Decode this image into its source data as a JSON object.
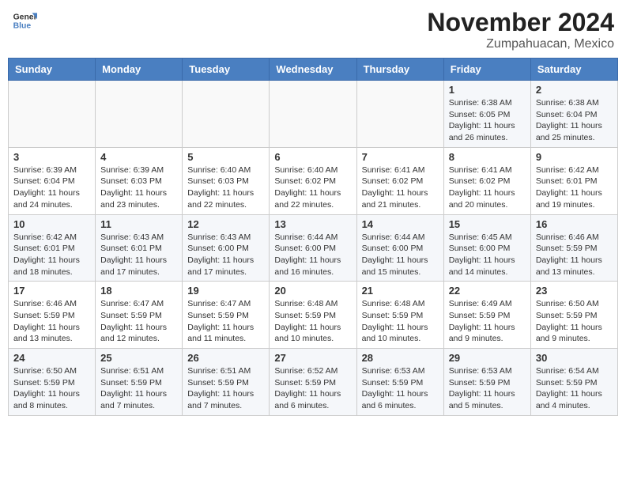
{
  "logo": {
    "name": "GeneralBlue",
    "line1": "General",
    "line2": "Blue"
  },
  "title": "November 2024",
  "location": "Zumpahuacan, Mexico",
  "weekdays": [
    "Sunday",
    "Monday",
    "Tuesday",
    "Wednesday",
    "Thursday",
    "Friday",
    "Saturday"
  ],
  "weeks": [
    [
      {
        "day": "",
        "info": ""
      },
      {
        "day": "",
        "info": ""
      },
      {
        "day": "",
        "info": ""
      },
      {
        "day": "",
        "info": ""
      },
      {
        "day": "",
        "info": ""
      },
      {
        "day": "1",
        "info": "Sunrise: 6:38 AM\nSunset: 6:05 PM\nDaylight: 11 hours and 26 minutes."
      },
      {
        "day": "2",
        "info": "Sunrise: 6:38 AM\nSunset: 6:04 PM\nDaylight: 11 hours and 25 minutes."
      }
    ],
    [
      {
        "day": "3",
        "info": "Sunrise: 6:39 AM\nSunset: 6:04 PM\nDaylight: 11 hours and 24 minutes."
      },
      {
        "day": "4",
        "info": "Sunrise: 6:39 AM\nSunset: 6:03 PM\nDaylight: 11 hours and 23 minutes."
      },
      {
        "day": "5",
        "info": "Sunrise: 6:40 AM\nSunset: 6:03 PM\nDaylight: 11 hours and 22 minutes."
      },
      {
        "day": "6",
        "info": "Sunrise: 6:40 AM\nSunset: 6:02 PM\nDaylight: 11 hours and 22 minutes."
      },
      {
        "day": "7",
        "info": "Sunrise: 6:41 AM\nSunset: 6:02 PM\nDaylight: 11 hours and 21 minutes."
      },
      {
        "day": "8",
        "info": "Sunrise: 6:41 AM\nSunset: 6:02 PM\nDaylight: 11 hours and 20 minutes."
      },
      {
        "day": "9",
        "info": "Sunrise: 6:42 AM\nSunset: 6:01 PM\nDaylight: 11 hours and 19 minutes."
      }
    ],
    [
      {
        "day": "10",
        "info": "Sunrise: 6:42 AM\nSunset: 6:01 PM\nDaylight: 11 hours and 18 minutes."
      },
      {
        "day": "11",
        "info": "Sunrise: 6:43 AM\nSunset: 6:01 PM\nDaylight: 11 hours and 17 minutes."
      },
      {
        "day": "12",
        "info": "Sunrise: 6:43 AM\nSunset: 6:00 PM\nDaylight: 11 hours and 17 minutes."
      },
      {
        "day": "13",
        "info": "Sunrise: 6:44 AM\nSunset: 6:00 PM\nDaylight: 11 hours and 16 minutes."
      },
      {
        "day": "14",
        "info": "Sunrise: 6:44 AM\nSunset: 6:00 PM\nDaylight: 11 hours and 15 minutes."
      },
      {
        "day": "15",
        "info": "Sunrise: 6:45 AM\nSunset: 6:00 PM\nDaylight: 11 hours and 14 minutes."
      },
      {
        "day": "16",
        "info": "Sunrise: 6:46 AM\nSunset: 5:59 PM\nDaylight: 11 hours and 13 minutes."
      }
    ],
    [
      {
        "day": "17",
        "info": "Sunrise: 6:46 AM\nSunset: 5:59 PM\nDaylight: 11 hours and 13 minutes."
      },
      {
        "day": "18",
        "info": "Sunrise: 6:47 AM\nSunset: 5:59 PM\nDaylight: 11 hours and 12 minutes."
      },
      {
        "day": "19",
        "info": "Sunrise: 6:47 AM\nSunset: 5:59 PM\nDaylight: 11 hours and 11 minutes."
      },
      {
        "day": "20",
        "info": "Sunrise: 6:48 AM\nSunset: 5:59 PM\nDaylight: 11 hours and 10 minutes."
      },
      {
        "day": "21",
        "info": "Sunrise: 6:48 AM\nSunset: 5:59 PM\nDaylight: 11 hours and 10 minutes."
      },
      {
        "day": "22",
        "info": "Sunrise: 6:49 AM\nSunset: 5:59 PM\nDaylight: 11 hours and 9 minutes."
      },
      {
        "day": "23",
        "info": "Sunrise: 6:50 AM\nSunset: 5:59 PM\nDaylight: 11 hours and 9 minutes."
      }
    ],
    [
      {
        "day": "24",
        "info": "Sunrise: 6:50 AM\nSunset: 5:59 PM\nDaylight: 11 hours and 8 minutes."
      },
      {
        "day": "25",
        "info": "Sunrise: 6:51 AM\nSunset: 5:59 PM\nDaylight: 11 hours and 7 minutes."
      },
      {
        "day": "26",
        "info": "Sunrise: 6:51 AM\nSunset: 5:59 PM\nDaylight: 11 hours and 7 minutes."
      },
      {
        "day": "27",
        "info": "Sunrise: 6:52 AM\nSunset: 5:59 PM\nDaylight: 11 hours and 6 minutes."
      },
      {
        "day": "28",
        "info": "Sunrise: 6:53 AM\nSunset: 5:59 PM\nDaylight: 11 hours and 6 minutes."
      },
      {
        "day": "29",
        "info": "Sunrise: 6:53 AM\nSunset: 5:59 PM\nDaylight: 11 hours and 5 minutes."
      },
      {
        "day": "30",
        "info": "Sunrise: 6:54 AM\nSunset: 5:59 PM\nDaylight: 11 hours and 4 minutes."
      }
    ]
  ]
}
